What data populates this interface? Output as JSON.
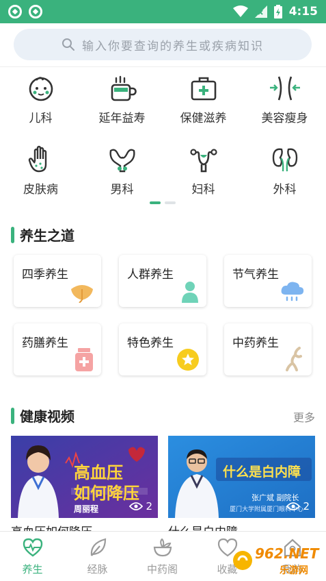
{
  "status_bar": {
    "time": "4:15",
    "accent": "#3ab27d"
  },
  "search": {
    "placeholder": "输入你要查询的养生或疾病知识"
  },
  "categories": [
    {
      "label": "儿科",
      "icon": "baby-face-icon"
    },
    {
      "label": "延年益寿",
      "icon": "tea-cup-icon"
    },
    {
      "label": "保健滋养",
      "icon": "medical-kit-icon"
    },
    {
      "label": "美容瘦身",
      "icon": "waist-slim-icon"
    },
    {
      "label": "皮肤病",
      "icon": "hand-skin-icon"
    },
    {
      "label": "男科",
      "icon": "male-organ-icon"
    },
    {
      "label": "妇科",
      "icon": "uterus-icon"
    },
    {
      "label": "外科",
      "icon": "kidney-icon"
    }
  ],
  "wellness": {
    "title": "养生之道",
    "items": [
      {
        "label": "四季养生",
        "icon": "ginkgo-leaf-icon"
      },
      {
        "label": "人群养生",
        "icon": "person-icon"
      },
      {
        "label": "节气养生",
        "icon": "rain-cloud-icon"
      },
      {
        "label": "药膳养生",
        "icon": "medicine-jar-icon"
      },
      {
        "label": "特色养生",
        "icon": "star-badge-icon"
      },
      {
        "label": "中药养生",
        "icon": "ginseng-root-icon"
      }
    ]
  },
  "videos": {
    "title": "健康视频",
    "more": "更多",
    "items": [
      {
        "title": "高血压如何降压",
        "views": "2",
        "overlay_lines": [
          "高血压",
          "如何降压"
        ],
        "doctor": "周丽程"
      },
      {
        "title": "什么是白内障",
        "views": "2",
        "overlay_lines": [
          "什么是白内障"
        ],
        "doctor": "张广斌",
        "doctor_title": "副院长",
        "hospital": "厦门大学附属厦门眼科中心"
      }
    ]
  },
  "tabs": [
    {
      "label": "养生",
      "icon": "heart-pulse-icon",
      "active": true
    },
    {
      "label": "经脉",
      "icon": "leaf-icon",
      "active": false
    },
    {
      "label": "中药阁",
      "icon": "herb-bowl-icon",
      "active": false
    },
    {
      "label": "收藏",
      "icon": "heart-icon",
      "active": false
    },
    {
      "label": "我的",
      "icon": "home-icon",
      "active": false
    }
  ],
  "watermark": {
    "text": "962.NET",
    "subtext": "乐游网"
  }
}
